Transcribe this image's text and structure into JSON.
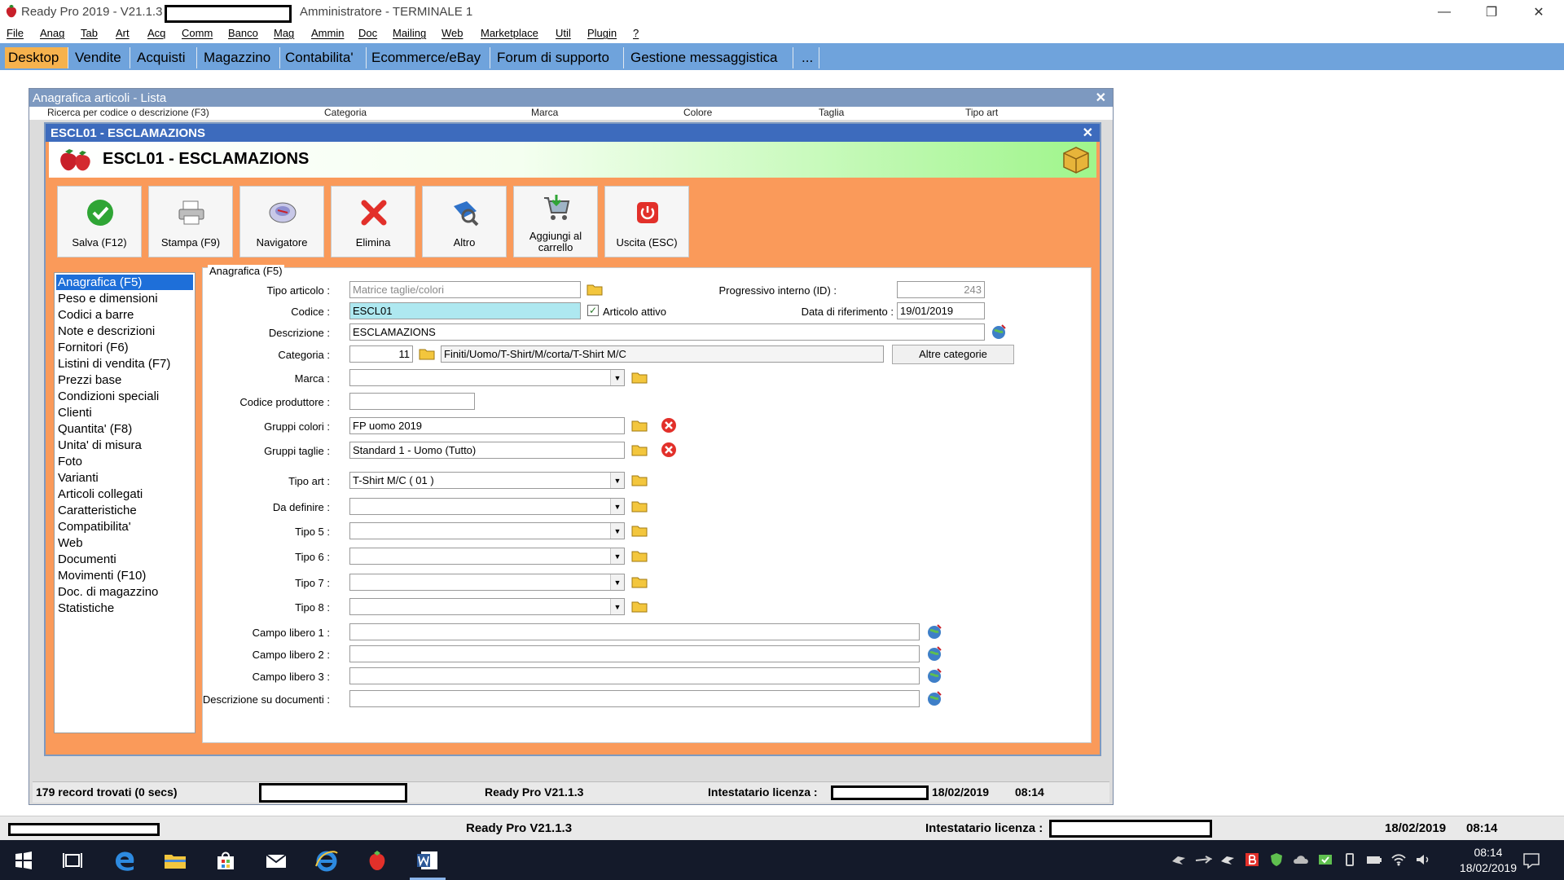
{
  "window": {
    "title": "Ready Pro 2019 - V21.1.3",
    "user": "Amministratore - TERMINALE 1"
  },
  "menu": [
    "File",
    "Anag",
    "Tab",
    "Art",
    "Acq",
    "Comm",
    "Banco",
    "Mag",
    "Ammin",
    "Doc",
    "Mailing",
    "Web",
    "Marketplace",
    "Util",
    "Plugin",
    "?"
  ],
  "tabs": [
    "Desktop",
    "Vendite",
    "Acquisti",
    "Magazzino",
    "Contabilita'",
    "Ecommerce/eBay",
    "Forum di supporto",
    "Gestione messaggistica",
    "..."
  ],
  "lista": {
    "title": "Anagrafica articoli  - Lista",
    "strip": [
      "Ricerca per codice o descrizione (F3)",
      "Categoria",
      "Marca",
      "Colore",
      "Taglia",
      "Tipo art"
    ],
    "status_count": "179 record trovati (0 secs)",
    "status_version": "Ready Pro V21.1.3",
    "status_license": "Intestatario licenza :",
    "status_date": "18/02/2019",
    "status_time": "08:14"
  },
  "article": {
    "window_title": "ESCL01 - ESCLAMAZIONS",
    "heading": "ESCL01 - ESCLAMAZIONS",
    "toolbar": [
      {
        "label": "Salva (F12)",
        "icon": "checkmark-icon"
      },
      {
        "label": "Stampa (F9)",
        "icon": "printer-icon"
      },
      {
        "label": "Navigatore",
        "icon": "navigator-icon"
      },
      {
        "label": "Elimina",
        "icon": "delete-x-icon"
      },
      {
        "label": "Altro",
        "icon": "magnifier-icon"
      },
      {
        "label": "Aggiungi al carrello",
        "icon": "cart-icon"
      },
      {
        "label": "Uscita (ESC)",
        "icon": "power-icon"
      }
    ],
    "sidebar": [
      "Anagrafica (F5)",
      "Peso e dimensioni",
      "Codici a barre",
      "Note e descrizioni",
      "Fornitori (F6)",
      "Listini di vendita (F7)",
      "Prezzi base",
      "Condizioni speciali",
      "Clienti",
      "Quantita' (F8)",
      "Unita' di misura",
      "Foto",
      "Varianti",
      "Articoli collegati",
      "Caratteristiche",
      "Compatibilita'",
      "Web",
      "Documenti",
      "Movimenti (F10)",
      "Doc. di magazzino",
      "Statistiche"
    ],
    "group_label": "Anagrafica (F5)",
    "form": {
      "tipo_articolo_label": "Tipo articolo :",
      "tipo_articolo_value": "Matrice taglie/colori",
      "codice_label": "Codice :",
      "codice_value": "ESCL01",
      "articolo_attivo_label": "Articolo attivo",
      "progressivo_label": "Progressivo interno (ID) :",
      "progressivo_value": "243",
      "data_rif_label": "Data di riferimento :",
      "data_rif_value": "19/01/2019",
      "descrizione_label": "Descrizione :",
      "descrizione_value": "ESCLAMAZIONS",
      "categoria_label": "Categoria :",
      "categoria_code": "11",
      "categoria_path": "Finiti/Uomo/T-Shirt/M/corta/T-Shirt M/C",
      "altre_categorie": "Altre categorie",
      "marca_label": "Marca :",
      "marca_value": "",
      "codice_produttore_label": "Codice produttore :",
      "codice_produttore_value": "",
      "gruppi_colori_label": "Gruppi colori :",
      "gruppi_colori_value": "FP uomo 2019",
      "gruppi_taglie_label": "Gruppi taglie :",
      "gruppi_taglie_value": "Standard 1 - Uomo (Tutto)",
      "tipo_art_label": "Tipo art :",
      "tipo_art_value": "T-Shirt M/C ( 01 )",
      "da_definire_label": "Da definire :",
      "tipo5_label": "Tipo 5 :",
      "tipo6_label": "Tipo 6 :",
      "tipo7_label": "Tipo 7 :",
      "tipo8_label": "Tipo 8 :",
      "campo1_label": "Campo libero 1 :",
      "campo2_label": "Campo libero 2 :",
      "campo3_label": "Campo libero 3 :",
      "desc_doc_label": "Descrizione su documenti :"
    }
  },
  "app_status": {
    "version": "Ready Pro V21.1.3",
    "license": "Intestatario licenza :",
    "date": "18/02/2019",
    "time": "08:14"
  },
  "taskbar": {
    "time": "08:14",
    "date": "18/02/2019"
  }
}
